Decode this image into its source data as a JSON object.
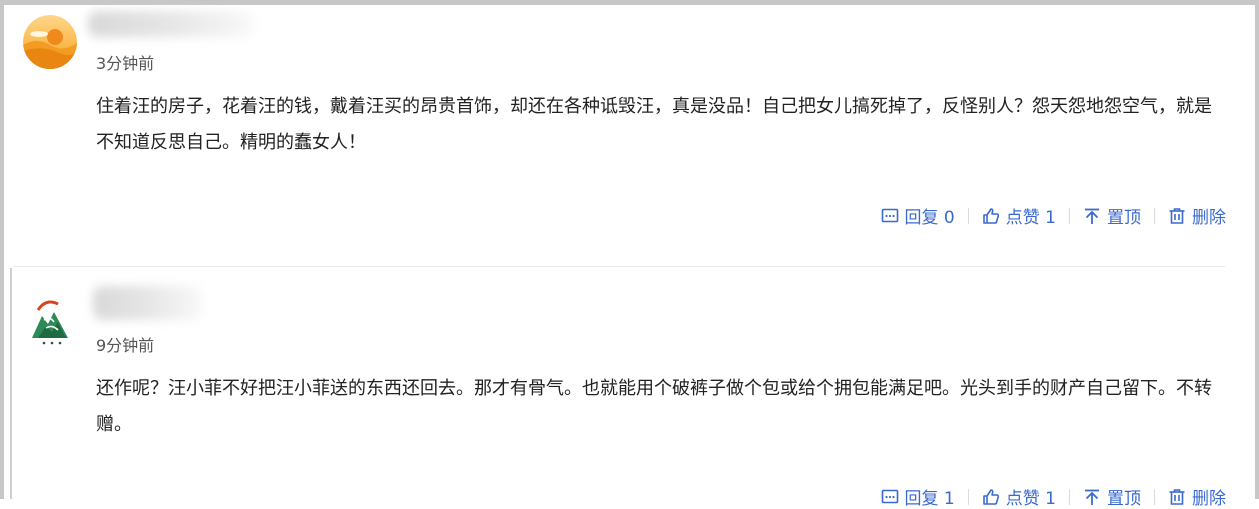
{
  "comments": [
    {
      "time": "3分钟前",
      "text": "住着汪的房子，花着汪的钱，戴着汪买的昂贵首饰，却还在各种诋毁汪，真是没品！自己把女儿搞死掉了，反怪别人？怨天怨地怨空气，就是不知道反思自己。精明的蠢女人！",
      "reply_label": "回复 0",
      "like_label": "点赞 1",
      "pin_label": "置顶",
      "delete_label": "删除"
    },
    {
      "time": "9分钟前",
      "text": "还作呢？汪小菲不好把汪小菲送的东西还回去。那才有骨气。也就能用个破裤子做个包或给个拥包能满足吧。光头到手的财产自己留下。不转赠。",
      "reply_label": "回复 1",
      "like_label": "点赞 1",
      "pin_label": "置顶",
      "delete_label": "删除"
    }
  ],
  "colors": {
    "action_blue": "#3a6ad0",
    "text": "#222222",
    "time": "#555555"
  },
  "icons": [
    "reply-icon",
    "thumbs-up-icon",
    "pin-top-icon",
    "trash-icon"
  ]
}
